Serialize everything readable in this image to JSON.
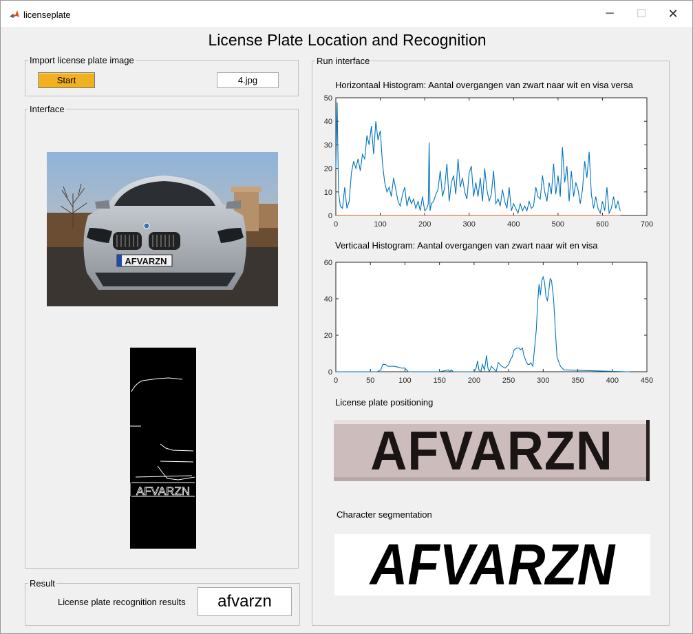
{
  "window": {
    "title": "licenseplate",
    "minimize_glyph": "─",
    "maximize_glyph": "☐",
    "close_glyph": "✕"
  },
  "main_title": "License Plate Location and Recognition",
  "import_panel": {
    "title": "Import license plate image",
    "start_label": "Start",
    "file_name": "4.jpg"
  },
  "interface_panel": {
    "title": "Interface",
    "car_plate_text": "AFVARZN",
    "edge_plate_text": "AFVARZN"
  },
  "result_panel": {
    "title": "Result",
    "label": "License plate recognition results",
    "value": "afvarzn"
  },
  "run_panel": {
    "title": "Run interface",
    "plate_positioning_title": "License plate positioning",
    "plate_positioning_text": "AFVARZN",
    "segmentation_title": "Character segmentation",
    "segmentation_text": "AFVARZN"
  },
  "colors": {
    "line_blue": "#0072bd",
    "line_orange": "#d95319",
    "button_yellow": "#f0b020"
  },
  "chart_data": [
    {
      "type": "line",
      "title": "Horizontaal Histogram: Aantal overgangen van zwart naar wit en visa versa",
      "xlabel": "",
      "ylabel": "",
      "xlim": [
        0,
        700
      ],
      "ylim": [
        0,
        50
      ],
      "xticks": [
        "0",
        "100",
        "200",
        "300",
        "400",
        "500",
        "600",
        "700"
      ],
      "yticks": [
        "0",
        "10",
        "20",
        "30",
        "40",
        "50"
      ],
      "grid": false,
      "series": [
        {
          "color": "#0072bd",
          "x": [
            0,
            3,
            6,
            10,
            15,
            20,
            25,
            30,
            35,
            40,
            45,
            50,
            55,
            60,
            65,
            70,
            75,
            80,
            85,
            90,
            95,
            100,
            105,
            110,
            115,
            120,
            125,
            130,
            135,
            140,
            145,
            150,
            155,
            160,
            165,
            170,
            175,
            180,
            185,
            190,
            195,
            200,
            205,
            208,
            210,
            212,
            215,
            220,
            225,
            230,
            235,
            240,
            245,
            250,
            255,
            260,
            265,
            270,
            275,
            280,
            285,
            290,
            295,
            300,
            305,
            310,
            315,
            320,
            325,
            330,
            335,
            340,
            345,
            350,
            355,
            360,
            365,
            370,
            375,
            380,
            385,
            390,
            395,
            400,
            405,
            410,
            415,
            420,
            425,
            430,
            435,
            440,
            445,
            450,
            455,
            460,
            465,
            470,
            475,
            480,
            485,
            490,
            495,
            500,
            505,
            510,
            515,
            520,
            525,
            530,
            535,
            540,
            545,
            550,
            555,
            560,
            565,
            570,
            575,
            580,
            585,
            590,
            595,
            600,
            605,
            610,
            615,
            620,
            625,
            630,
            635,
            640
          ],
          "y": [
            20,
            48,
            10,
            4,
            3,
            12,
            3,
            6,
            18,
            23,
            20,
            24,
            19,
            26,
            24,
            34,
            30,
            38,
            26,
            40,
            32,
            36,
            22,
            14,
            10,
            12,
            8,
            16,
            11,
            6,
            4,
            9,
            12,
            4,
            8,
            5,
            7,
            3,
            6,
            2,
            8,
            2,
            3,
            5,
            31,
            2,
            5,
            6,
            9,
            11,
            19,
            8,
            12,
            22,
            6,
            14,
            17,
            9,
            24,
            12,
            16,
            10,
            7,
            18,
            21,
            8,
            14,
            8,
            16,
            6,
            20,
            11,
            6,
            9,
            19,
            5,
            7,
            4,
            11,
            6,
            3,
            12,
            2,
            5,
            3,
            1,
            5,
            2,
            4,
            2,
            6,
            3,
            4,
            12,
            8,
            7,
            17,
            10,
            6,
            14,
            9,
            22,
            9,
            17,
            8,
            29,
            14,
            21,
            6,
            19,
            8,
            14,
            11,
            5,
            11,
            23,
            16,
            27,
            9,
            3,
            8,
            3,
            1,
            6,
            2,
            12,
            1,
            3,
            8,
            3,
            6,
            2
          ]
        },
        {
          "color": "#d95319",
          "x": [
            0,
            640
          ],
          "y": [
            0,
            0
          ]
        }
      ]
    },
    {
      "type": "line",
      "title": "Verticaal Histogram: Aantal overgangen van zwart naar wit en visa",
      "xlabel": "",
      "ylabel": "",
      "xlim": [
        0,
        450
      ],
      "ylim": [
        0,
        60
      ],
      "xticks": [
        "0",
        "50",
        "100",
        "150",
        "200",
        "250",
        "300",
        "350",
        "400",
        "450"
      ],
      "yticks": [
        "0",
        "20",
        "40",
        "60"
      ],
      "grid": false,
      "series": [
        {
          "color": "#0072bd",
          "x": [
            0,
            60,
            65,
            68,
            72,
            75,
            80,
            85,
            95,
            100,
            105,
            150,
            163,
            165,
            167,
            170,
            200,
            203,
            205,
            207,
            210,
            212,
            215,
            218,
            220,
            222,
            225,
            230,
            232,
            235,
            240,
            245,
            250,
            253,
            255,
            258,
            262,
            265,
            267,
            270,
            272,
            274,
            276,
            278,
            280,
            282,
            285,
            290,
            292,
            294,
            296,
            298,
            300,
            302,
            304,
            306,
            308,
            310,
            312,
            315,
            318,
            320,
            325,
            330,
            420,
            425
          ],
          "y": [
            0,
            0,
            1,
            4,
            4,
            3,
            3,
            3,
            2,
            2,
            0,
            0,
            1,
            0,
            1,
            0,
            0,
            2,
            6,
            1,
            0,
            4,
            1,
            9,
            2,
            0,
            3,
            1,
            0,
            5,
            3,
            2,
            4,
            7,
            8,
            12,
            13,
            13,
            12,
            13,
            9,
            7,
            5,
            4,
            4,
            5,
            3,
            23,
            38,
            48,
            42,
            50,
            52,
            49,
            41,
            39,
            44,
            51,
            50,
            40,
            20,
            8,
            3,
            1,
            0,
            0
          ]
        }
      ]
    }
  ]
}
